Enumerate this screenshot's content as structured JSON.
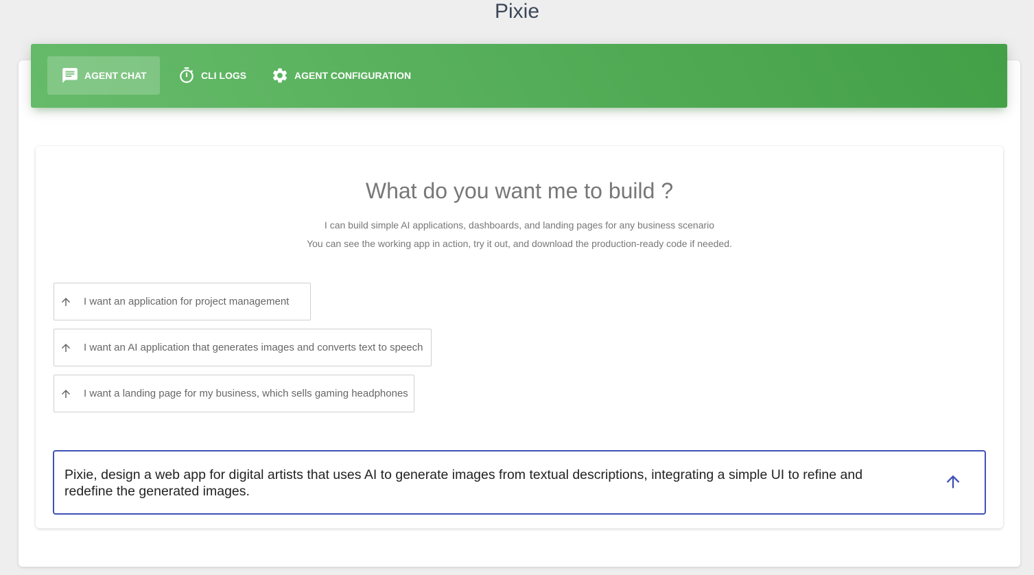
{
  "app": {
    "title": "Pixie"
  },
  "nav": {
    "accent": "#4caf50",
    "tabs": [
      {
        "label": "AGENT CHAT",
        "icon": "chat-icon",
        "active": true
      },
      {
        "label": "CLI LOGS",
        "icon": "timer-icon",
        "active": false
      },
      {
        "label": "AGENT CONFIGURATION",
        "icon": "gear-icon",
        "active": false
      }
    ]
  },
  "main": {
    "headline": "What do you want me to build ?",
    "subtitle_line1": "I can build simple AI applications, dashboards, and landing pages for any business scenario",
    "subtitle_line2": "You can see the working app in action, try it out, and download the production-ready code if needed.",
    "suggestions": [
      {
        "label": "I want an application for project management",
        "icon": "arrow-up-icon"
      },
      {
        "label": "I want an AI application that generates images and converts text to speech",
        "icon": "arrow-up-icon"
      },
      {
        "label": "I want a landing page for my business, which sells gaming headphones",
        "icon": "arrow-up-icon"
      }
    ],
    "prompt": {
      "value": "Pixie, design a web app for digital artists that uses AI to generate images from textual descriptions, integrating a simple UI to refine and redefine the generated images.",
      "border_color": "#3f51b5",
      "send_icon": "arrow-up-icon"
    }
  }
}
